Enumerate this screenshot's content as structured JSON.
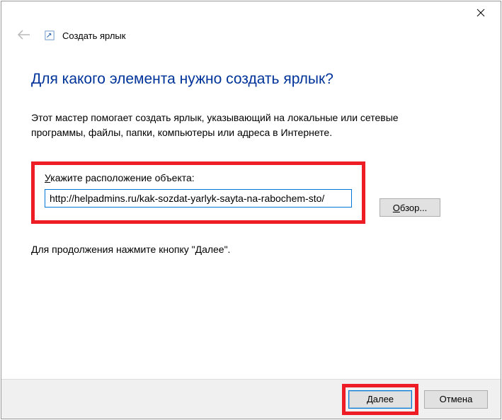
{
  "titlebar": {},
  "header": {
    "title": "Создать ярлык"
  },
  "main": {
    "heading": "Для какого элемента нужно создать ярлык?",
    "description_line1": "Этот мастер помогает создать ярлык, указывающий на локальные или сетевые",
    "description_line2": "программы, файлы, папки, компьютеры или адреса в Интернете.",
    "input_label_underlined": "У",
    "input_label_rest": "кажите расположение объекта:",
    "input_value": "http://helpadmins.ru/kak-sozdat-yarlyk-sayta-na-rabochem-sto/",
    "browse_underlined": "О",
    "browse_rest": "бзор...",
    "continue_text": "Для продолжения нажмите кнопку \"Далее\"."
  },
  "footer": {
    "next_underlined": "Д",
    "next_rest": "алее",
    "cancel_label": "Отмена"
  }
}
